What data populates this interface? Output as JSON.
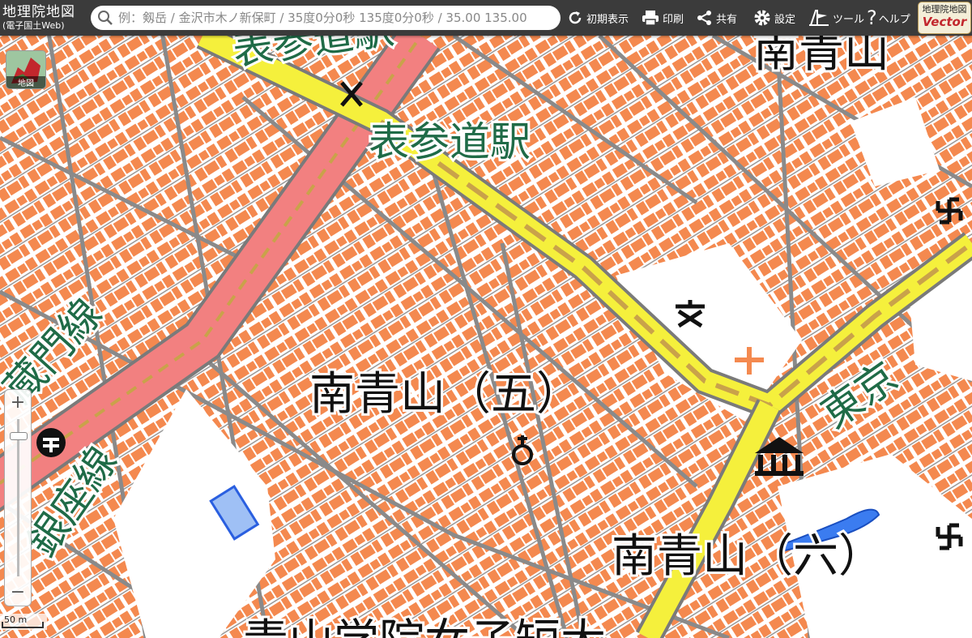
{
  "app": {
    "title": "地理院地図",
    "subtitle": "(電子国土Web)"
  },
  "search": {
    "placeholder": "例：剱岳 / 金沢市木ノ新保町 / 35度0分0秒 135度0分0秒 / 35.00 135.00"
  },
  "toolbar": {
    "home_label": "初期表示",
    "print_label": "印刷",
    "share_label": "共有",
    "settings_label": "設定",
    "tools_label": "ツール",
    "help_label": "ヘルプ"
  },
  "badge": {
    "line1": "地理院地図",
    "line2": "Vector"
  },
  "layer_button": {
    "label": "地図"
  },
  "zoom": {
    "in_label": "+",
    "out_label": "−"
  },
  "scale": {
    "label": "50 m"
  },
  "map_labels": {
    "station_top": "表参道駅",
    "station_main": "表参道駅",
    "district_top": "南青山",
    "district_5": "南青山（五）",
    "district_6": "南青山（六）",
    "hanzomon_line": "蔵門線",
    "ginza_line": "銀座線",
    "tokyo": "東京",
    "bottom_partial": "青山学院女子短大"
  },
  "colors": {
    "building": "#f4894f",
    "road_major": "#f28080",
    "road_yellow": "#f5f03c",
    "pond": "#3b7cf0",
    "label_green": "#1f6b47",
    "toolbar_bg": "#3b3b3b"
  },
  "symbols": [
    "school-symbol",
    "temple-symbol",
    "museum-symbol",
    "police-box-symbol",
    "hospital-symbol",
    "subway-station-symbol",
    "post-office-symbol"
  ]
}
